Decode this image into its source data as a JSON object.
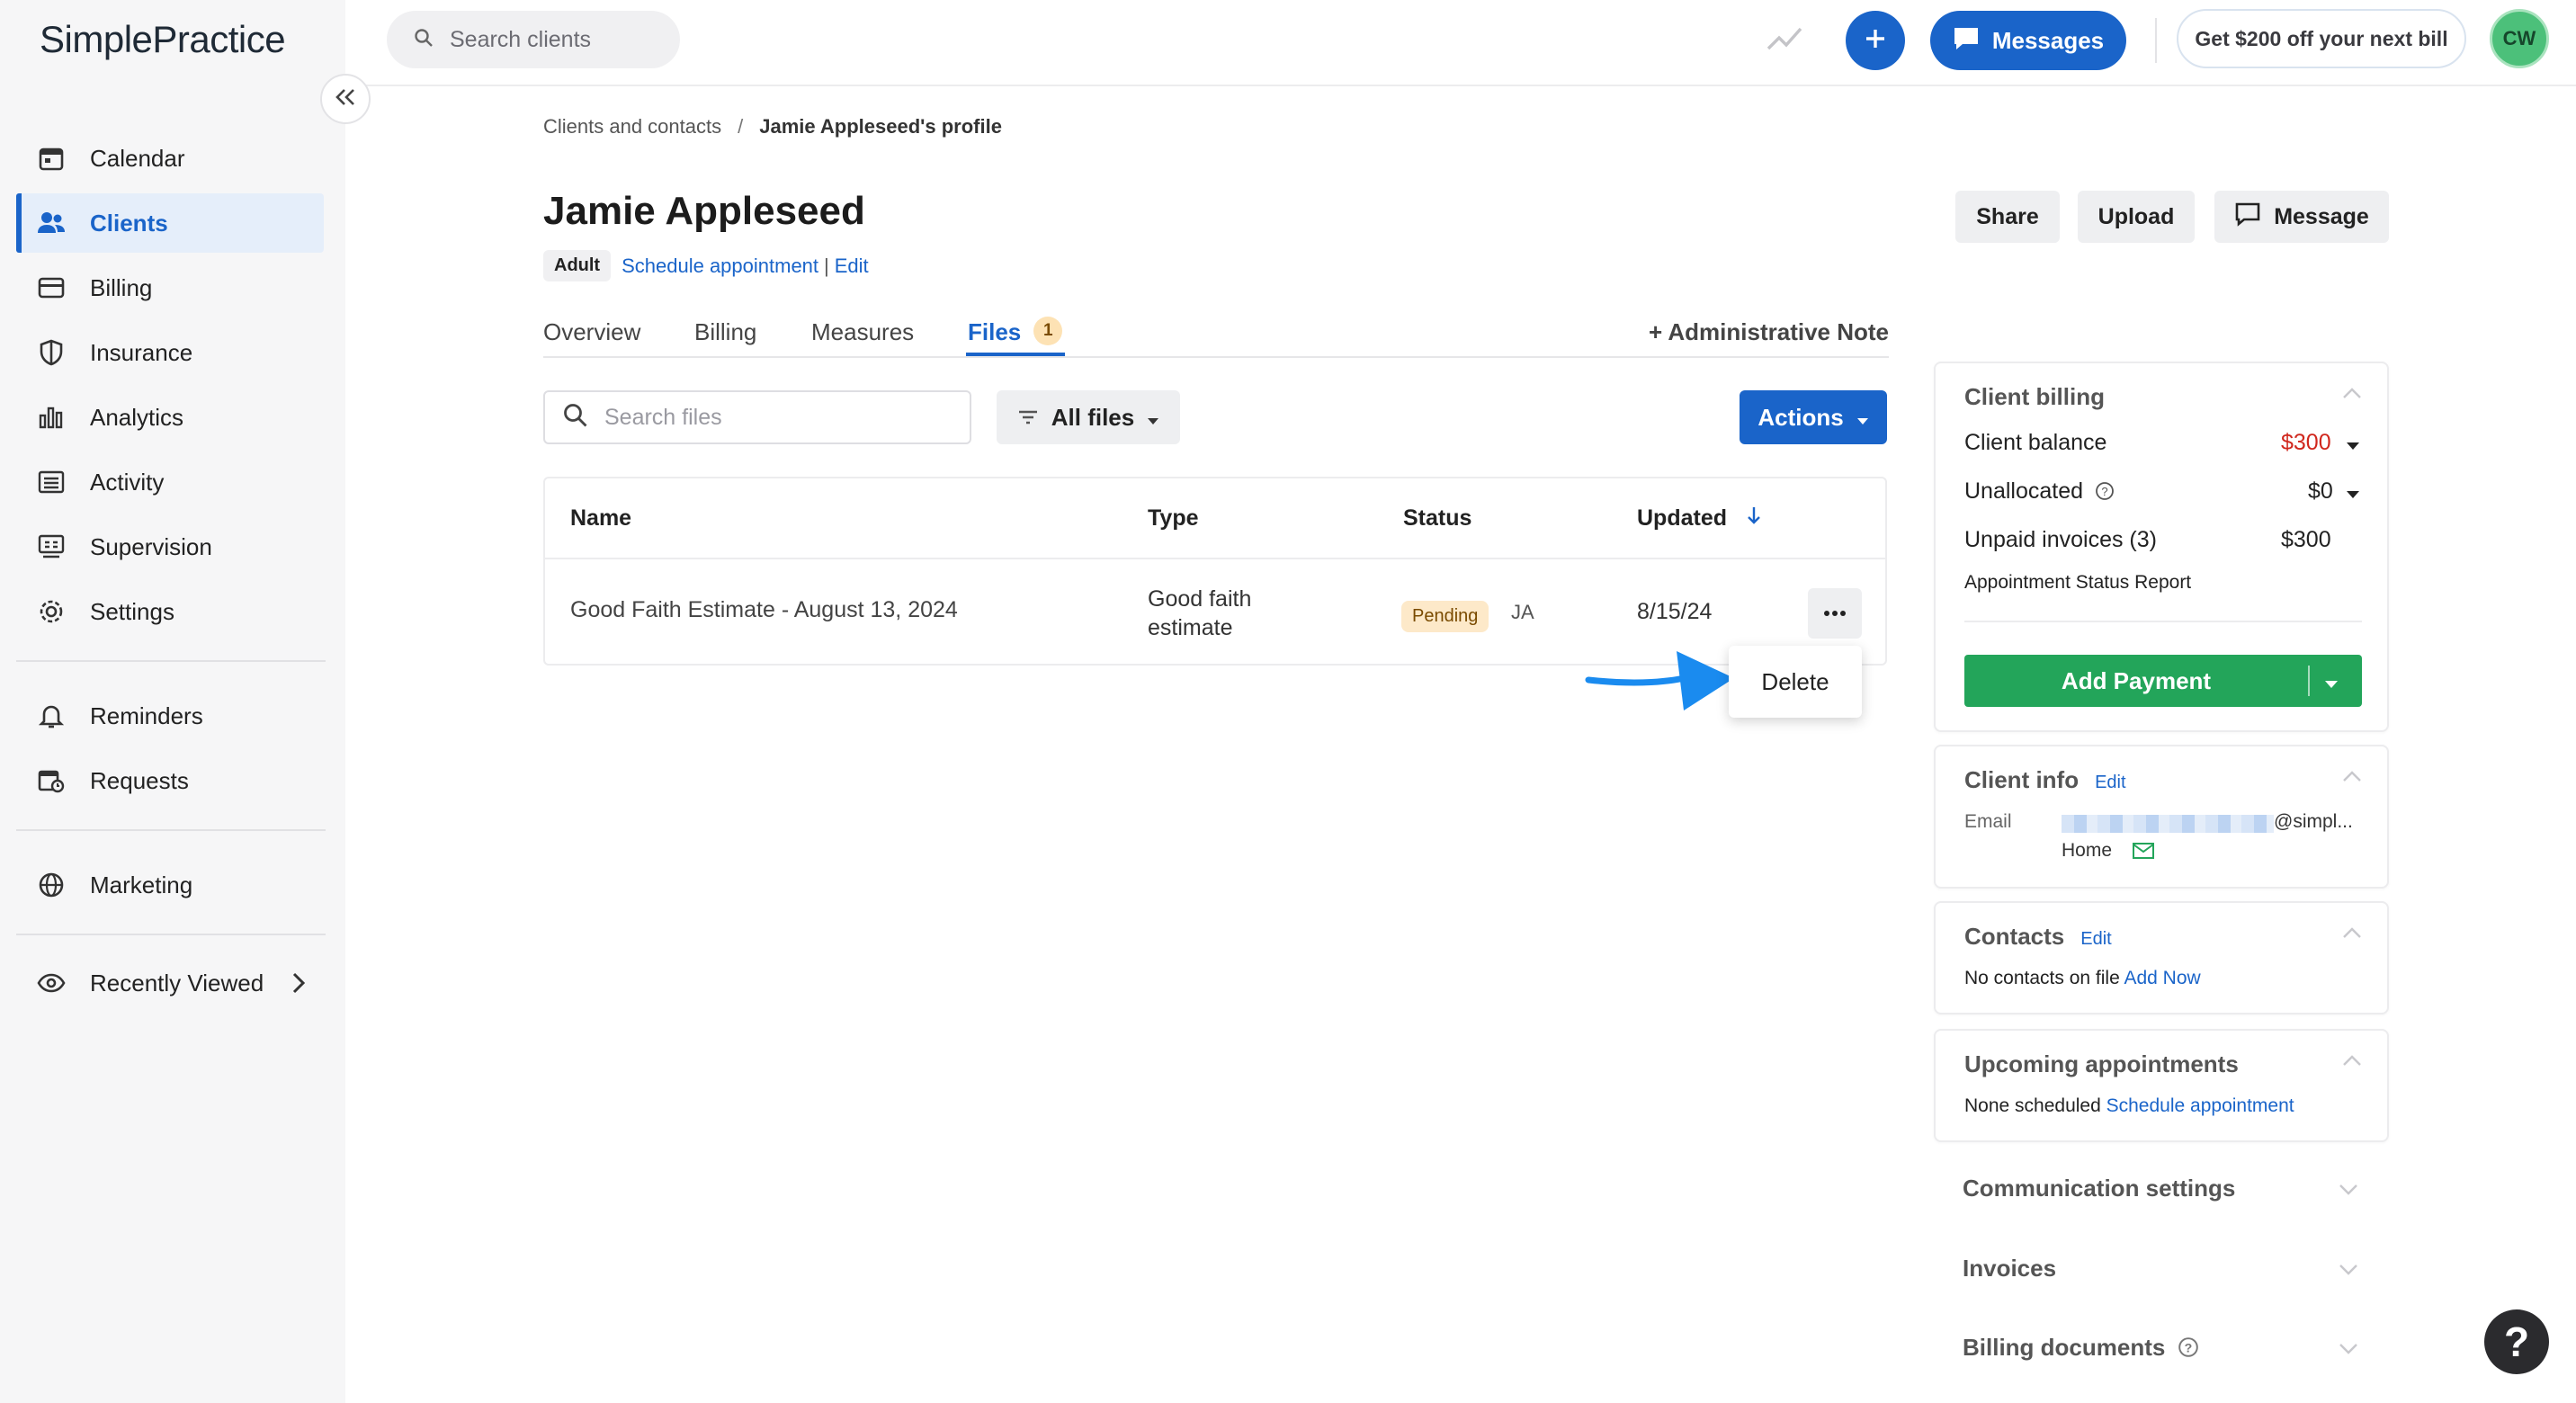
{
  "app": {
    "logo": "SimplePractice"
  },
  "sidebar": {
    "items": [
      {
        "label": "Calendar",
        "icon": "calendar-icon"
      },
      {
        "label": "Clients",
        "icon": "users-icon",
        "active": true
      },
      {
        "label": "Billing",
        "icon": "card-icon"
      },
      {
        "label": "Insurance",
        "icon": "shield-icon"
      },
      {
        "label": "Analytics",
        "icon": "bar-chart-icon"
      },
      {
        "label": "Activity",
        "icon": "list-icon"
      },
      {
        "label": "Supervision",
        "icon": "supervision-icon"
      },
      {
        "label": "Settings",
        "icon": "gear-icon"
      },
      {
        "label": "Reminders",
        "icon": "bell-icon"
      },
      {
        "label": "Requests",
        "icon": "calendar-clock-icon"
      },
      {
        "label": "Marketing",
        "icon": "globe-icon"
      },
      {
        "label": "Recently Viewed",
        "icon": "eye-icon"
      }
    ]
  },
  "topbar": {
    "search_placeholder": "Search clients",
    "messages_label": "Messages",
    "promo_label": "Get $200 off your next bill",
    "avatar_initials": "CW"
  },
  "breadcrumb": {
    "parent": "Clients and contacts",
    "separator": "/",
    "current": "Jamie Appleseed's profile"
  },
  "client": {
    "name": "Jamie Appleseed",
    "badge": "Adult",
    "schedule_link": "Schedule appointment",
    "meta_separator": "|",
    "edit_link": "Edit"
  },
  "header_buttons": {
    "share": "Share",
    "upload": "Upload",
    "message": "Message"
  },
  "tabs": {
    "overview": "Overview",
    "billing": "Billing",
    "measures": "Measures",
    "files": "Files",
    "files_count": "1",
    "admin_note": "+ Administrative Note"
  },
  "files_toolbar": {
    "search_placeholder": "Search files",
    "filter_label": "All files",
    "actions_label": "Actions"
  },
  "files_table": {
    "headers": {
      "name": "Name",
      "type": "Type",
      "status": "Status",
      "updated": "Updated"
    },
    "rows": [
      {
        "name": "Good Faith Estimate - August 13, 2024",
        "type_line1": "Good faith",
        "type_line2": "estimate",
        "status": "Pending",
        "initials": "JA",
        "updated": "8/15/24"
      }
    ],
    "row_menu": {
      "delete": "Delete"
    }
  },
  "client_billing": {
    "title": "Client billing",
    "balance_label": "Client balance",
    "balance_value": "$300",
    "unallocated_label": "Unallocated",
    "unallocated_value": "$0",
    "unpaid_label": "Unpaid invoices (3)",
    "unpaid_value": "$300",
    "status_report": "Appointment Status Report",
    "add_payment": "Add Payment"
  },
  "client_info": {
    "title": "Client info",
    "edit": "Edit",
    "email_label": "Email",
    "email_value": "@simpl...",
    "email_type": "Home"
  },
  "contacts": {
    "title": "Contacts",
    "edit": "Edit",
    "empty": "No contacts on file",
    "add_now": "Add Now"
  },
  "upcoming": {
    "title": "Upcoming appointments",
    "none": "None scheduled",
    "schedule": "Schedule appointment"
  },
  "collapsed_sections": {
    "communication": "Communication settings",
    "invoices": "Invoices",
    "billing_documents": "Billing documents"
  },
  "help": {
    "label": "?"
  },
  "colors": {
    "brand": "#1a64c9",
    "success": "#23a55a",
    "danger": "#d0271d",
    "pending_bg": "#fde9c9"
  }
}
